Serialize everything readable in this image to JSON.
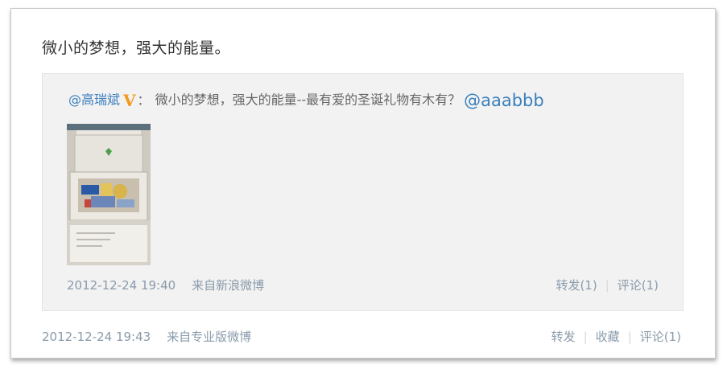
{
  "post": {
    "text": "微小的梦想，强大的能量。",
    "timestamp": "2012-12-24 19:43",
    "source": "来自专业版微博",
    "actions": {
      "repost": "转发",
      "favorite": "收藏",
      "comment": "评论(1)"
    }
  },
  "repost": {
    "author": "@高瑞斌",
    "verified_badge": "V",
    "colon": "：",
    "text": "微小的梦想，强大的能量--最有爱的圣诞礼物有木有？",
    "mention": "@aaabbb",
    "timestamp": "2012-12-24 19:40",
    "source": "来自新浪微博",
    "actions": {
      "repost": "转发(1)",
      "comment": "评论(1)"
    }
  },
  "colors": {
    "link": "#3b7fbd",
    "meta": "#8a9bab",
    "badge": "#f39a1c",
    "repost_bg": "#f2f2f2"
  }
}
